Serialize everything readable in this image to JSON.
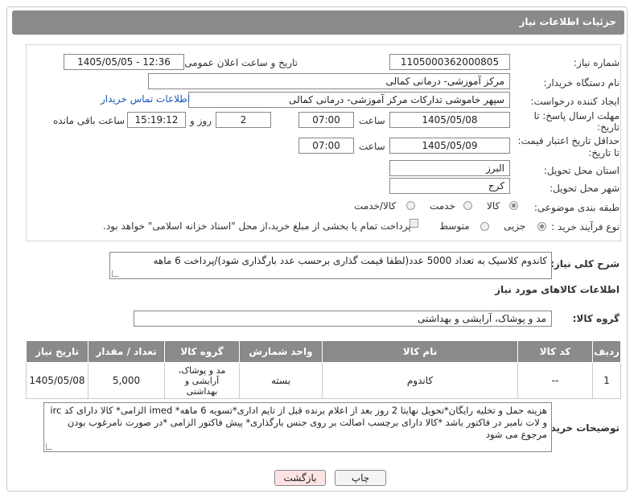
{
  "header": {
    "title": "جزئیات اطلاعات نیاز"
  },
  "form": {
    "need_number_label": "شماره نیاز:",
    "need_number": "1105000362000805",
    "announce_label": "تاریخ و ساعت اعلان عمومی:",
    "announce_value": "1405/05/05 - 12:36",
    "buyer_org_label": "نام دستگاه خریدار:",
    "buyer_org": "مرکز آموزشی- درمانی کمالی",
    "requester_label": "ایجاد کننده درخواست:",
    "requester": "سپهر خاموشی تدارکات مرکز آموزشی- درمانی کمالی",
    "contact_link": "اطلاعات تماس خریدار",
    "deadline_label_1": "مهلت ارسال پاسخ: تا",
    "deadline_label_2": "تاریخ:",
    "deadline_date": "1405/05/08",
    "time_label": "ساعت",
    "deadline_time": "07:00",
    "days_value": "2",
    "days_label": "روز و",
    "remaining_time": "15:19:12",
    "remaining_label": "ساعت باقی مانده",
    "validity_label_1": "حداقل تاریخ اعتبار قیمت:",
    "validity_label_2": "تا تاریخ:",
    "validity_date": "1405/05/09",
    "validity_time": "07:00",
    "province_label": "استان محل تحویل:",
    "province": "البرز",
    "city_label": "شهر محل تحویل:",
    "city": "کرج",
    "category_label": "طبقه بندی موضوعی:",
    "category_options": [
      "کالا",
      "خدمت",
      "کالا/خدمت"
    ],
    "process_label": "نوع فرآیند خرید :",
    "process_options": [
      "جزیی",
      "متوسط"
    ],
    "payment_note": "پرداخت تمام یا بخشی از مبلغ خرید،از محل \"اسناد خزانه اسلامی\" خواهد بود."
  },
  "description": {
    "label": "شرح کلی نیاز:",
    "text": "کاندوم کلاسیک به تعداد 5000 عدد(لطفا قیمت گذاری برحسب عدد بارگذاری شود)/پرداخت 6 ماهه"
  },
  "goods_info": {
    "title": "اطلاعات کالاهای مورد نیاز"
  },
  "goods_group": {
    "label": "گروه کالا:",
    "value": "مد و پوشاک، آرایشی و بهداشتی"
  },
  "table": {
    "headers": [
      "ردیف",
      "کد کالا",
      "نام کالا",
      "واحد شمارش",
      "گروه کالا",
      "تعداد / مقدار",
      "تاریخ نیاز"
    ],
    "rows": [
      {
        "index": "1",
        "code": "--",
        "name": "کاندوم",
        "unit": "بسته",
        "group": "مد و پوشاک، آرایشی و بهداشتی",
        "qty": "5,000",
        "date": "1405/05/08"
      }
    ]
  },
  "buyer_notes": {
    "label": "توضیحات خریدار:",
    "text": "هزینه حمل و تخلیه رایگان*تحویل نهایتا 2 روز بعد از اعلام برنده قبل از تایم اداری*تسویه 6 ماهه* imed الزامی* کالا دارای کد irc و لات نامبر در فاکتور باشد *کالا دارای برچسب اصالت بر روی جنس بارگذاری* پیش فاکتور الزامی *در صورت نامرغوب بودن مرجوع می شود"
  },
  "buttons": {
    "print": "چاپ",
    "back": "بازگشت"
  },
  "colors": {
    "header_bg": "#8a8a8a",
    "link": "#1a55b8",
    "back_btn_bg": "#fde3e3"
  }
}
